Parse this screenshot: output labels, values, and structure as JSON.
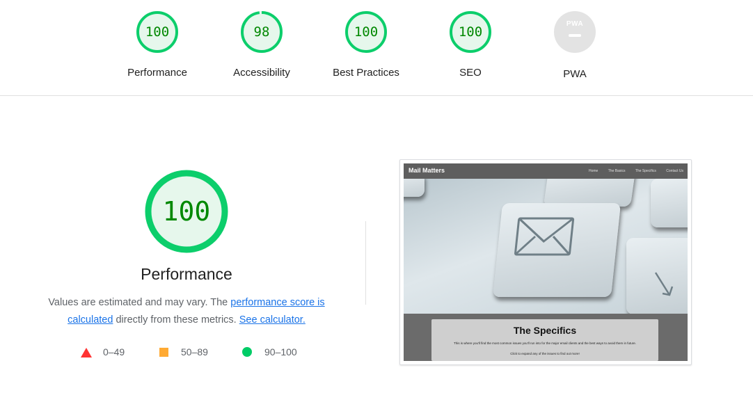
{
  "gauges": [
    {
      "label": "Performance",
      "score": "100",
      "value": 100
    },
    {
      "label": "Accessibility",
      "score": "98",
      "value": 98
    },
    {
      "label": "Best Practices",
      "score": "100",
      "value": 100
    },
    {
      "label": "SEO",
      "score": "100",
      "value": 100
    }
  ],
  "pwa": {
    "label": "PWA",
    "badge_text": "PWA"
  },
  "performance": {
    "score": "100",
    "value": 100,
    "title": "Performance",
    "desc_prefix": "Values are estimated and may vary. The ",
    "link_score": "performance score is calculated",
    "desc_middle": " directly from these metrics. ",
    "link_calculator": "See calculator."
  },
  "legend": {
    "fail": "0–49",
    "average": "50–89",
    "pass": "90–100"
  },
  "thumbnail": {
    "site_title": "Mail Matters",
    "nav": [
      "Home",
      "The Basics",
      "The Specifics",
      "Contact Us"
    ],
    "heading": "The Specifics",
    "text1": "This is where you'll find the most common issues you'll run into for the major email clients and the best ways to avoid them in future.",
    "text2": "Click to expand any of the issues to find out more!"
  },
  "colors": {
    "pass": "#0cce6b",
    "pass_text": "#008800",
    "pass_fill": "#e6f7ec",
    "fail": "#ff3333",
    "average": "#ffaa33",
    "link": "#1a73e8",
    "pwa_grey": "#e3e3e3"
  }
}
